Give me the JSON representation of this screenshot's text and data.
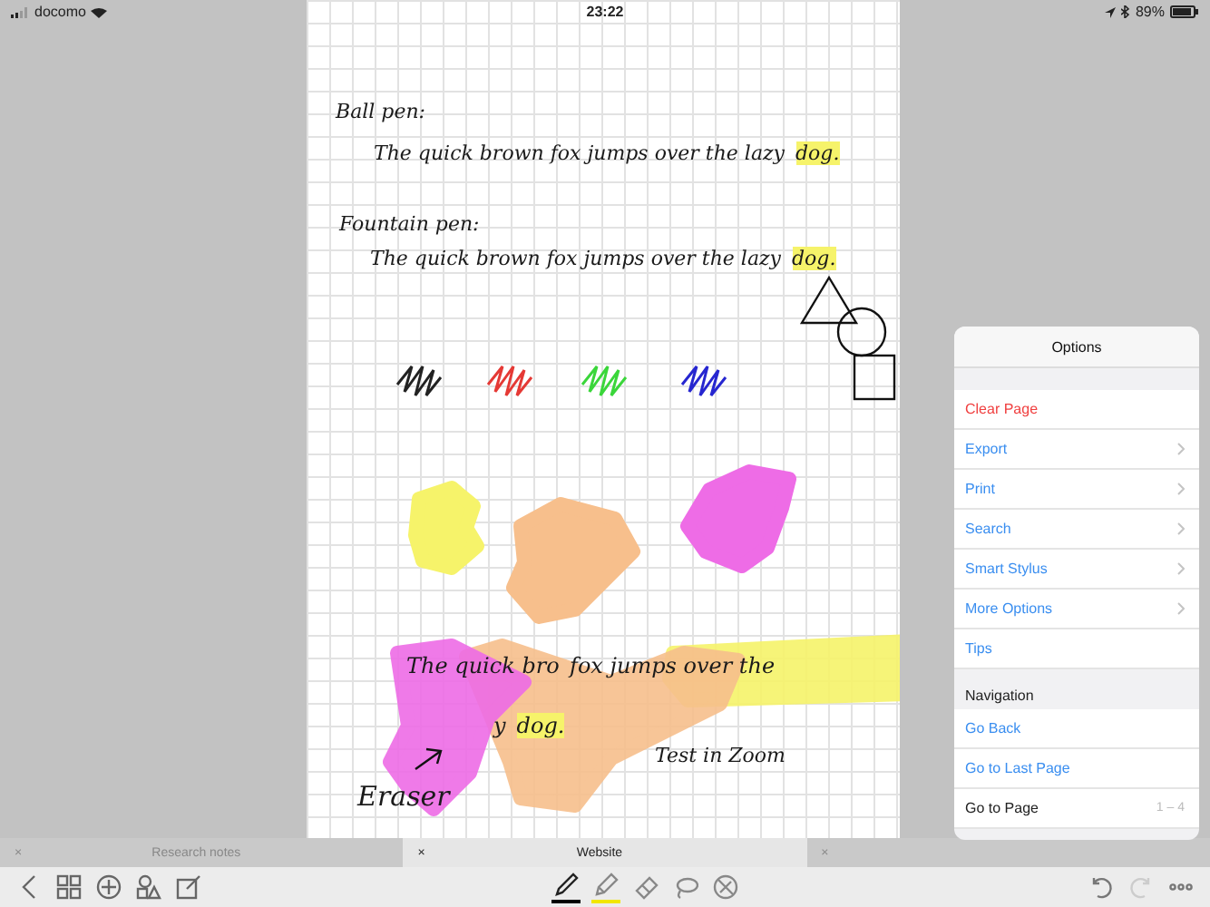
{
  "status_bar": {
    "carrier": "docomo",
    "time": "23:22",
    "battery": "89%"
  },
  "page": {
    "handwriting": [
      {
        "words": [
          {
            "text": "Ball pen:",
            "highlight": false
          }
        ]
      },
      {
        "words": [
          {
            "text": "The quick brown fox jumps over the lazy",
            "highlight": false
          },
          {
            "text": "dog.",
            "highlight": true
          }
        ]
      },
      {
        "words": [
          {
            "text": "Fountain pen:",
            "highlight": false
          }
        ]
      },
      {
        "words": [
          {
            "text": "The quick brown fox jumps over the lazy",
            "highlight": false
          },
          {
            "text": "dog.",
            "highlight": true
          }
        ]
      },
      {
        "words": [
          {
            "text": "The quick bro",
            "highlight": false
          }
        ]
      },
      {
        "words": [
          {
            "text": "fox jumps over the",
            "highlight": false
          }
        ]
      },
      {
        "words": [
          {
            "text": "y",
            "highlight": false
          },
          {
            "text": "dog.",
            "highlight": true
          }
        ]
      },
      {
        "words": [
          {
            "text": "Test in Zoom",
            "highlight": false
          }
        ]
      },
      {
        "words": [
          {
            "text": "Eraser",
            "highlight": false
          }
        ]
      }
    ],
    "scribbles": [
      {
        "color": "#222222"
      },
      {
        "color": "#e53935"
      },
      {
        "color": "#3ad63a"
      },
      {
        "color": "#2626d0"
      }
    ],
    "highlights": [
      {
        "color": "#f6f36a"
      },
      {
        "color": "#f7bf8c"
      },
      {
        "color": "#ee6ce6"
      }
    ]
  },
  "options": {
    "title": "Options",
    "groups": [
      {
        "items": [
          {
            "label": "Clear Page",
            "kind": "destructive",
            "chevron": false
          },
          {
            "label": "Export",
            "kind": "action",
            "chevron": true
          },
          {
            "label": "Print",
            "kind": "action",
            "chevron": true
          },
          {
            "label": "Search",
            "kind": "action",
            "chevron": true
          },
          {
            "label": "Smart Stylus",
            "kind": "action",
            "chevron": true
          },
          {
            "label": "More Options",
            "kind": "action",
            "chevron": true
          },
          {
            "label": "Tips",
            "kind": "action",
            "chevron": false
          }
        ]
      },
      {
        "header": "Navigation",
        "items": [
          {
            "label": "Go Back",
            "kind": "action",
            "chevron": false
          },
          {
            "label": "Go to Last Page",
            "kind": "action",
            "chevron": false
          },
          {
            "label": "Go to Page",
            "kind": "plain",
            "chevron": false,
            "detail": "1 – 4"
          }
        ]
      }
    ]
  },
  "tabs": [
    {
      "close": "×",
      "label": "Research notes",
      "selected": false
    },
    {
      "close": "×",
      "label": "Website",
      "selected": true
    },
    {
      "close": "×",
      "selected": false
    }
  ],
  "toolbar": {
    "left": [
      {
        "kind": "back"
      },
      {
        "kind": "pages"
      },
      {
        "kind": "add"
      },
      {
        "kind": "shapes"
      },
      {
        "kind": "edit"
      }
    ],
    "tools": [
      {
        "kind": "pen",
        "selected": true,
        "color": "#000000"
      },
      {
        "kind": "highlighter",
        "selected": false,
        "color": "#f2e600"
      },
      {
        "kind": "eraser",
        "selected": false
      },
      {
        "kind": "lasso",
        "selected": false
      },
      {
        "kind": "stylus",
        "selected": false
      }
    ],
    "right": [
      {
        "kind": "undo",
        "disabled": false
      },
      {
        "kind": "redo",
        "disabled": true
      },
      {
        "kind": "more",
        "disabled": false
      }
    ]
  }
}
